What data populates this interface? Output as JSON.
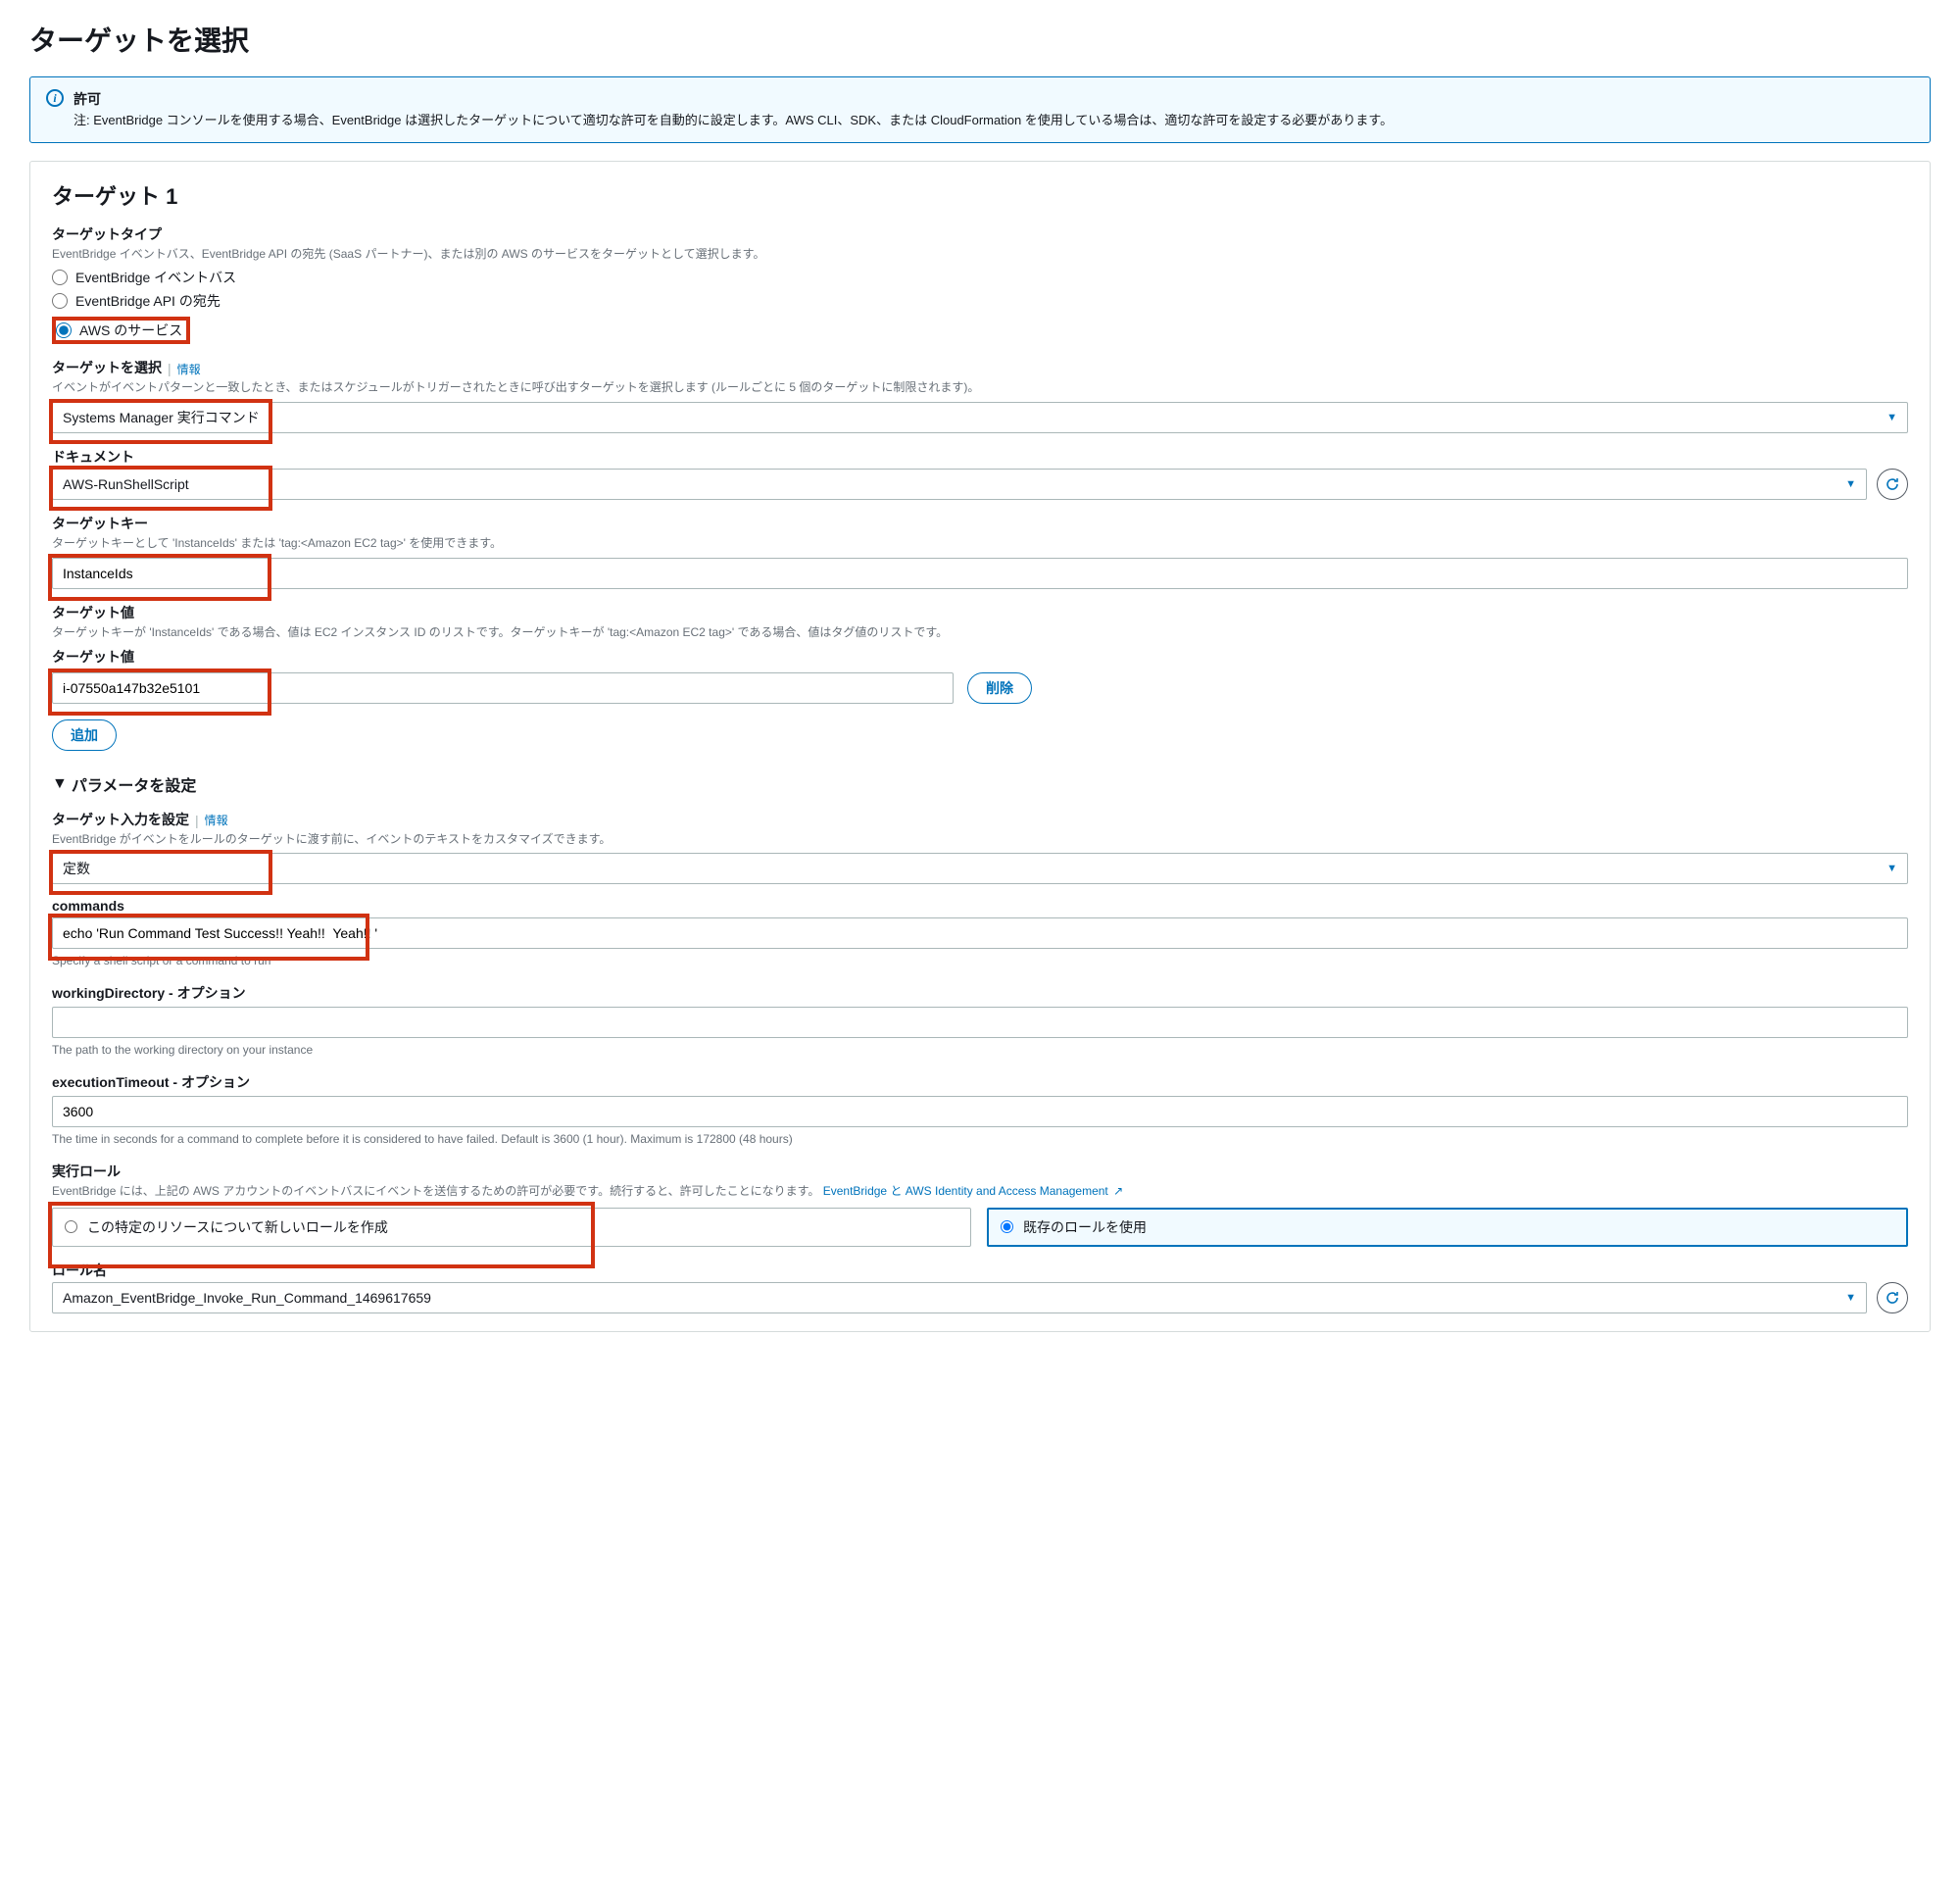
{
  "page": {
    "title": "ターゲットを選択"
  },
  "permission": {
    "title": "許可",
    "text": "注: EventBridge コンソールを使用する場合、EventBridge は選択したターゲットについて適切な許可を自動的に設定します。AWS CLI、SDK、または CloudFormation を使用している場合は、適切な許可を設定する必要があります。"
  },
  "target1": {
    "title": "ターゲット 1",
    "type_label": "ターゲットタイプ",
    "type_helper": "EventBridge イベントバス、EventBridge API の宛先 (SaaS パートナー)、または別の AWS のサービスをターゲットとして選択します。",
    "radio_eventbus": "EventBridge イベントバス",
    "radio_api": "EventBridge API の宛先",
    "radio_aws": "AWS のサービス",
    "select_target_label": "ターゲットを選択",
    "info": "情報",
    "select_target_helper": "イベントがイベントパターンと一致したとき、またはスケジュールがトリガーされたときに呼び出すターゲットを選択します (ルールごとに 5 個のターゲットに制限されます)。",
    "select_target_value": "Systems Manager 実行コマンド",
    "document_label": "ドキュメント",
    "document_value": "AWS-RunShellScript",
    "target_key_label": "ターゲットキー",
    "target_key_helper": "ターゲットキーとして 'InstanceIds' または 'tag:<Amazon EC2 tag>' を使用できます。",
    "target_key_value": "InstanceIds",
    "target_value_label": "ターゲット値",
    "target_value_helper": "ターゲットキーが 'InstanceIds' である場合、値は EC2 インスタンス ID のリストです。ターゲットキーが 'tag:<Amazon EC2 tag>' である場合、値はタグ値のリストです。",
    "target_value_sub": "ターゲット値",
    "target_value_input": "i-07550a147b32e5101",
    "delete": "削除",
    "add": "追加"
  },
  "params": {
    "header": "パラメータを設定",
    "input_label": "ターゲット入力を設定",
    "input_helper": "EventBridge がイベントをルールのターゲットに渡す前に、イベントのテキストをカスタマイズできます。",
    "input_value": "定数",
    "commands_label": "commands",
    "commands_value": "echo 'Run Command Test Success!! Yeah!!  Yeah!! '",
    "commands_helper": "Specify a shell script or a command to run",
    "workdir_label": "workingDirectory - オプション",
    "workdir_value": "",
    "workdir_helper": "The path to the working directory on your instance",
    "timeout_label": "executionTimeout - オプション",
    "timeout_value": "3600",
    "timeout_helper": "The time in seconds for a command to complete before it is considered to have failed. Default is 3600 (1 hour). Maximum is 172800 (48 hours)"
  },
  "role": {
    "label": "実行ロール",
    "helper_pre": "EventBridge には、上記の AWS アカウントのイベントバスにイベントを送信するための許可が必要です。続行すると、許可したことになります。",
    "helper_link": "EventBridge と AWS Identity and Access Management",
    "option_new": "この特定のリソースについて新しいロールを作成",
    "option_existing": "既存のロールを使用",
    "name_label": "ロール名",
    "name_value": "Amazon_EventBridge_Invoke_Run_Command_1469617659"
  }
}
